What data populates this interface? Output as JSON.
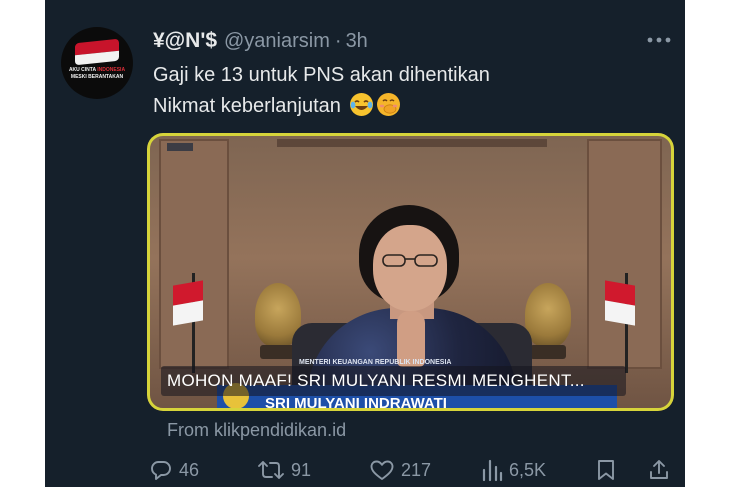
{
  "tweet": {
    "author": {
      "display_name": "¥@N'$",
      "handle": "@yaniarsim",
      "avatar_text_line1_a": "AKU CINTA ",
      "avatar_text_line1_b": "INDONESIA",
      "avatar_text_line2": "MESKI BERANTAKAN"
    },
    "separator": "·",
    "time": "3h",
    "more_icon": "more-horizontal-icon",
    "text_line1": "Gaji ke 13 untuk PNS akan dihentikan",
    "text_line2": "Nikmat keberlanjutan",
    "emojis": [
      "face-with-tears-of-joy-emoji",
      "face-with-hand-over-mouth-emoji"
    ],
    "media": {
      "caption": "MOHON MAAF! SRI MULYANI RESMI MENGHENT...",
      "nameplate_title": "MENTERI KEUANGAN REPUBLIK INDONESIA",
      "nameplate_name": "SRI MULYANI INDRAWATI",
      "frame_color": "#d6d43a"
    },
    "source": "From klikpendidikan.id",
    "actions": {
      "reply": {
        "icon": "reply-icon",
        "count": "46"
      },
      "retweet": {
        "icon": "retweet-icon",
        "count": "91"
      },
      "like": {
        "icon": "heart-icon",
        "count": "217"
      },
      "views": {
        "icon": "views-chart-icon",
        "count": "6,5K"
      },
      "bookmark": {
        "icon": "bookmark-icon"
      },
      "share": {
        "icon": "share-icon"
      }
    }
  },
  "colors": {
    "background": "#15202b",
    "primary_text": "#e7e9ea",
    "secondary_text": "#8b98a5"
  }
}
